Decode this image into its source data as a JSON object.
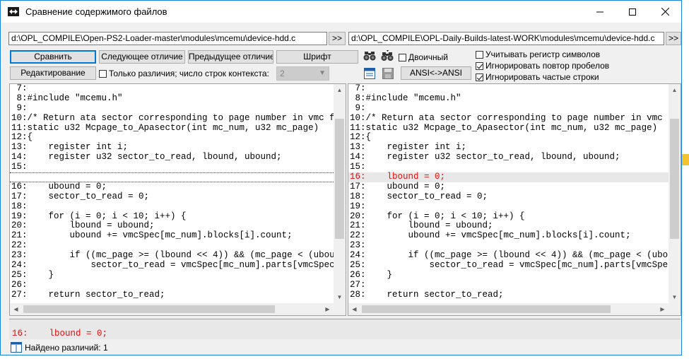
{
  "window": {
    "title": "Сравнение содержимого файлов",
    "accent": "#1883d7"
  },
  "paths": {
    "left": "d:\\OPL_COMPILE\\Open-PS2-Loader-master\\modules\\mcemu\\device-hdd.c",
    "right": "d:\\OPL_COMPILE\\OPL-Daily-Builds-latest-WORK\\modules\\mcemu\\device-hdd.c",
    "browse_label": ">>"
  },
  "toolbar": {
    "compare": "Сравнить",
    "next_diff": "Следующее отличие",
    "prev_diff": "Предыдущее отличие",
    "font": "Шрифт",
    "edit": "Редактирование",
    "ansi": "ANSI<->ANSI",
    "binary": "Двоичный",
    "only_diffs": "Только различия; число строк контекста:",
    "context_value": "2"
  },
  "options": {
    "case": {
      "label": "Учитывать регистр символов",
      "checked": false
    },
    "spaces": {
      "label": "Игнорировать повтор пробелов",
      "checked": true
    },
    "frequent": {
      "label": "Игнорировать частые строки",
      "checked": true
    }
  },
  "left_lines": [
    {
      "text": " 7:",
      "kind": "normal"
    },
    {
      "text": " 8:#include \"mcemu.h\"",
      "kind": "normal"
    },
    {
      "text": " 9:",
      "kind": "normal"
    },
    {
      "text": "10:/* Return ata sector corresponding to page number in vmc file",
      "kind": "normal"
    },
    {
      "text": "11:static u32 Mcpage_to_Apasector(int mc_num, u32 mc_page)",
      "kind": "normal"
    },
    {
      "text": "12:{",
      "kind": "normal"
    },
    {
      "text": "13:    register int i;",
      "kind": "normal"
    },
    {
      "text": "14:    register u32 sector_to_read, lbound, ubound;",
      "kind": "normal"
    },
    {
      "text": "15:",
      "kind": "normal"
    },
    {
      "text": "",
      "kind": "gap"
    },
    {
      "text": "16:    ubound = 0;",
      "kind": "normal"
    },
    {
      "text": "17:    sector_to_read = 0;",
      "kind": "normal"
    },
    {
      "text": "18:",
      "kind": "normal"
    },
    {
      "text": "19:    for (i = 0; i < 10; i++) {",
      "kind": "normal"
    },
    {
      "text": "20:        lbound = ubound;",
      "kind": "normal"
    },
    {
      "text": "21:        ubound += vmcSpec[mc_num].blocks[i].count;",
      "kind": "normal"
    },
    {
      "text": "22:",
      "kind": "normal"
    },
    {
      "text": "23:        if ((mc_page >= (lbound << 4)) && (mc_page < (ubound <",
      "kind": "normal"
    },
    {
      "text": "24:            sector_to_read = vmcSpec[mc_num].parts[vmcSpec[mc_",
      "kind": "normal"
    },
    {
      "text": "25:    }",
      "kind": "normal"
    },
    {
      "text": "26:",
      "kind": "normal"
    },
    {
      "text": "27:    return sector_to_read;",
      "kind": "normal"
    }
  ],
  "right_lines": [
    {
      "text": " 7:",
      "kind": "normal"
    },
    {
      "text": " 8:#include \"mcemu.h\"",
      "kind": "normal"
    },
    {
      "text": " 9:",
      "kind": "normal"
    },
    {
      "text": "10:/* Return ata sector corresponding to page number in vmc file",
      "kind": "normal"
    },
    {
      "text": "11:static u32 Mcpage_to_Apasector(int mc_num, u32 mc_page)",
      "kind": "normal"
    },
    {
      "text": "12:{",
      "kind": "normal"
    },
    {
      "text": "13:    register int i;",
      "kind": "normal"
    },
    {
      "text": "14:    register u32 sector_to_read, lbound, ubound;",
      "kind": "normal"
    },
    {
      "text": "15:",
      "kind": "normal"
    },
    {
      "text": "16:    lbound = 0;",
      "kind": "diff"
    },
    {
      "text": "17:    ubound = 0;",
      "kind": "normal"
    },
    {
      "text": "18:    sector_to_read = 0;",
      "kind": "normal"
    },
    {
      "text": "19:",
      "kind": "normal"
    },
    {
      "text": "20:    for (i = 0; i < 10; i++) {",
      "kind": "normal"
    },
    {
      "text": "21:        lbound = ubound;",
      "kind": "normal"
    },
    {
      "text": "22:        ubound += vmcSpec[mc_num].blocks[i].count;",
      "kind": "normal"
    },
    {
      "text": "23:",
      "kind": "normal"
    },
    {
      "text": "24:        if ((mc_page >= (lbound << 4)) && (mc_page < (ubound <",
      "kind": "normal"
    },
    {
      "text": "25:            sector_to_read = vmcSpec[mc_num].parts[vmcSpec[mc_",
      "kind": "normal"
    },
    {
      "text": "26:    }",
      "kind": "normal"
    },
    {
      "text": "27:",
      "kind": "normal"
    },
    {
      "text": "28:    return sector_to_read;",
      "kind": "normal"
    }
  ],
  "bottom_line": "16:    lbound = 0;",
  "status": {
    "text": "Найдено различий: 1"
  },
  "colors": {
    "diff_text": "#e01010",
    "diff_bg": "#e8e8e8"
  }
}
